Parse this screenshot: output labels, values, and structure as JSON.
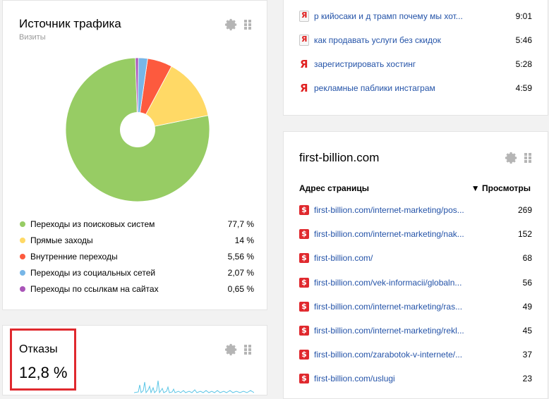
{
  "traffic": {
    "title": "Источник трафика",
    "subtitle": "Визиты",
    "legend": [
      {
        "label": "Переходы из поисковых систем",
        "value": "77,7 %",
        "color": "#97cc64"
      },
      {
        "label": "Прямые заходы",
        "value": "14 %",
        "color": "#ffd966"
      },
      {
        "label": "Внутренние переходы",
        "value": "5,56 %",
        "color": "#fd5a3e"
      },
      {
        "label": "Переходы из социальных сетей",
        "value": "2,07 %",
        "color": "#77b6e7"
      },
      {
        "label": "Переходы по ссылкам на сайтах",
        "value": "0,65 %",
        "color": "#a955b8"
      }
    ]
  },
  "chart_data": {
    "type": "pie",
    "categories": [
      "Переходы из поисковых систем",
      "Прямые заходы",
      "Внутренние переходы",
      "Переходы из социальных сетей",
      "Переходы по ссылкам на сайтах"
    ],
    "values": [
      77.7,
      14,
      5.56,
      2.07,
      0.65
    ],
    "colors": [
      "#97cc64",
      "#ffd966",
      "#fd5a3e",
      "#77b6e7",
      "#a955b8"
    ],
    "title": "Источник трафика",
    "subtitle": "Визиты",
    "donut": true
  },
  "bounce": {
    "title": "Отказы",
    "value": "12,8 %",
    "highlight_color": "#e0292e",
    "sparkline_color": "#5cc6e6"
  },
  "searches": {
    "rows": [
      {
        "phrase": "р кийосаки и д трамп почему мы хот...",
        "time": "9:01",
        "icon": "yandex-boxed-icon"
      },
      {
        "phrase": "как продавать услуги без скидок",
        "time": "5:46",
        "icon": "yandex-boxed-icon"
      },
      {
        "phrase": "зарегистрировать хостинг",
        "time": "5:28",
        "icon": "yandex-icon"
      },
      {
        "phrase": "рекламные паблики инстаграм",
        "time": "4:59",
        "icon": "yandex-icon"
      }
    ]
  },
  "pages": {
    "title": "first-billion.com",
    "col_url": "Адрес страницы",
    "col_views": "▼ Просмотры",
    "rows": [
      {
        "url": "first-billion.com/internet-marketing/pos...",
        "views": "269"
      },
      {
        "url": "first-billion.com/internet-marketing/nak...",
        "views": "152"
      },
      {
        "url": "first-billion.com/",
        "views": "68"
      },
      {
        "url": "first-billion.com/vek-informacii/globaln...",
        "views": "56"
      },
      {
        "url": "first-billion.com/internet-marketing/ras...",
        "views": "49"
      },
      {
        "url": "first-billion.com/internet-marketing/rekl...",
        "views": "45"
      },
      {
        "url": "first-billion.com/zarabotok-v-internete/...",
        "views": "37"
      },
      {
        "url": "first-billion.com/uslugi",
        "views": "23"
      }
    ]
  }
}
